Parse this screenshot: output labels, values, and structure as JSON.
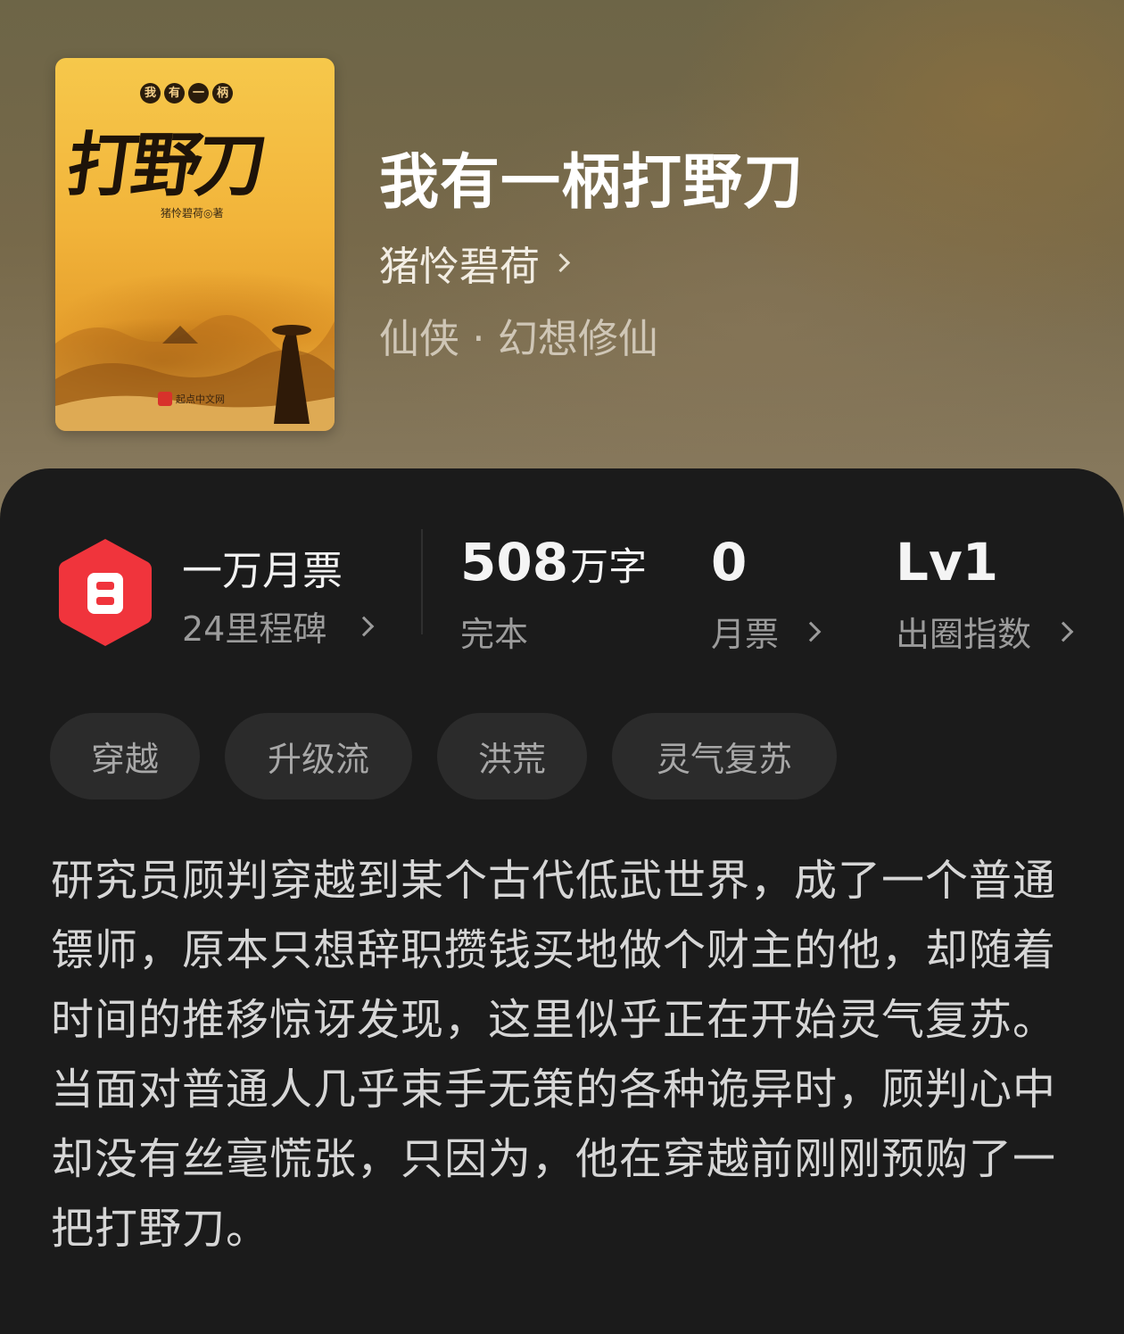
{
  "book": {
    "title": "我有一柄打野刀",
    "author": "猪怜碧荷",
    "category": "仙侠 · 幻想修仙"
  },
  "cover": {
    "subtitle_chars": [
      "我",
      "有",
      "一",
      "柄"
    ],
    "title": "打野刀",
    "author_line": "猪怜碧荷◎著",
    "publisher": "起点中文网"
  },
  "stats": {
    "monthly_ticket_title": "一万月票",
    "monthly_ticket_sub": "24里程碑",
    "word_count": "508",
    "word_unit": "万字",
    "status": "完本",
    "votes": "0",
    "votes_label": "月票",
    "level": "Lv1",
    "level_label": "出圈指数"
  },
  "tags": [
    "穿越",
    "升级流",
    "洪荒",
    "灵气复苏"
  ],
  "description": {
    "p1": "研究员顾判穿越到某个古代低武世界，成了一个普通镖师，原本只想辞职攒钱买地做个财主的他，却随着时间的推移惊讶发现，这里似乎正在开始灵气复苏。",
    "p2": "当面对普通人几乎束手无策的各种诡异时，顾判心中却没有丝毫慌张，只因为，他在穿越前刚刚预购了一把打野刀。"
  },
  "colors": {
    "accent_red": "#f0343c",
    "panel_bg": "#1b1b1b",
    "tag_bg": "#2b2b2b"
  }
}
